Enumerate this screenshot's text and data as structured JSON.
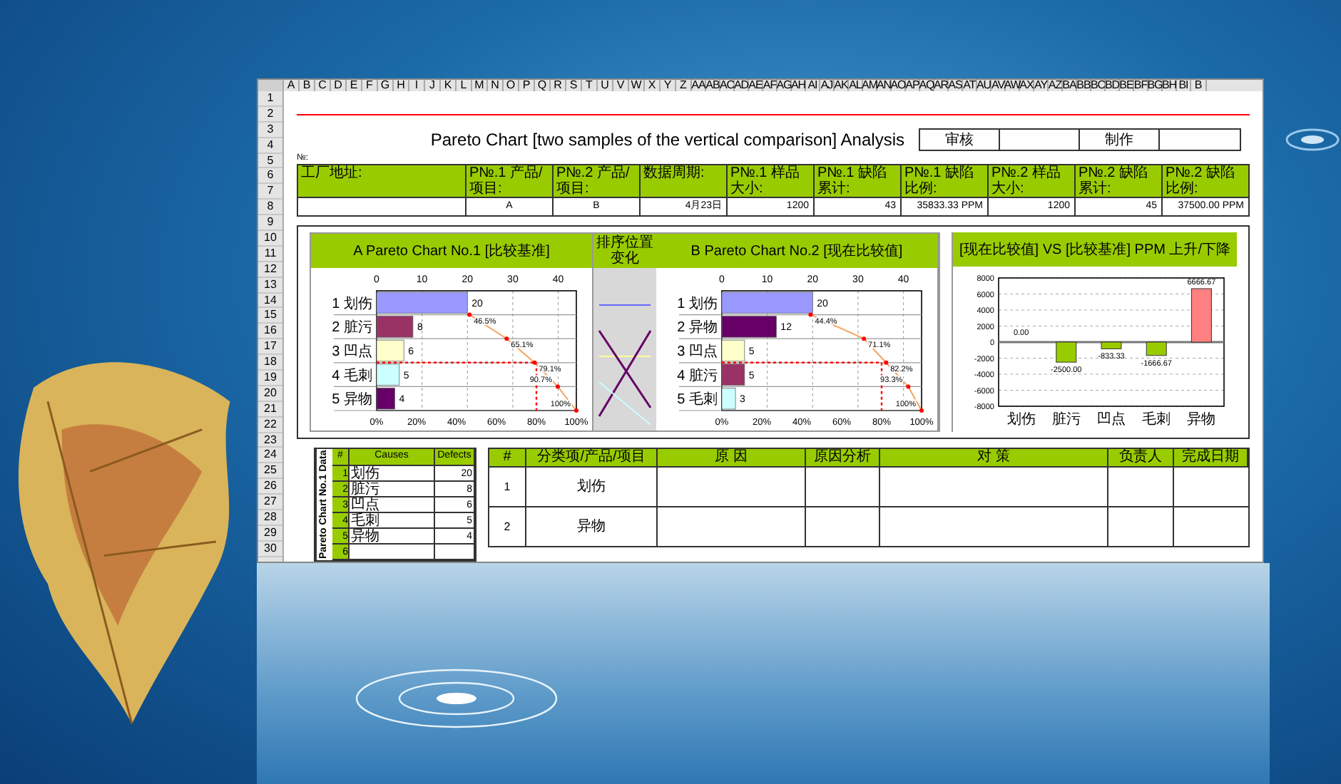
{
  "sheet": {
    "column_headers": [
      "A",
      "B",
      "C",
      "D",
      "E",
      "F",
      "G",
      "H",
      "I",
      "J",
      "K",
      "L",
      "M",
      "N",
      "O",
      "P",
      "Q",
      "R",
      "S",
      "T",
      "U",
      "V",
      "W",
      "X",
      "Y",
      "Z",
      "AA",
      "AB",
      "AC",
      "AD",
      "AE",
      "AF",
      "AG",
      "AH",
      "AI",
      "AJ",
      "AK",
      "AL",
      "AM",
      "AN",
      "AO",
      "AP",
      "AQ",
      "AR",
      "AS",
      "AT",
      "AU",
      "AV",
      "AW",
      "AX",
      "AY",
      "AZ",
      "BA",
      "BB",
      "BC",
      "BD",
      "BE",
      "BF",
      "BG",
      "BH",
      "BI",
      "B"
    ],
    "row_numbers": [
      "1",
      "2",
      "3",
      "4",
      "5",
      "6",
      "7",
      "8",
      "9",
      "10",
      "11",
      "12",
      "13",
      "14",
      "15",
      "16",
      "17",
      "18",
      "19",
      "20",
      "21",
      "22",
      "23",
      "24",
      "25",
      "26",
      "27",
      "28",
      "29",
      "30"
    ],
    "title": "Pareto Chart [two samples of the vertical comparison] Analysis",
    "signoff": [
      {
        "label": "审核"
      },
      {
        "label": "制作"
      }
    ],
    "number_label": "№:",
    "info_table": [
      {
        "label": "工厂地址:"
      },
      {
        "label": "P№.1 产品/项目:",
        "value": "A"
      },
      {
        "label": "P№.2 产品/项目:",
        "value": "B"
      },
      {
        "label": "数据周期:",
        "value": "4月23日"
      },
      {
        "label": "P№.1 样品大小:",
        "value": "1200"
      },
      {
        "label": "P№.1 缺陷累计:",
        "value": "43"
      },
      {
        "label": "P№.1 缺陷比例:",
        "value": "35833.33 PPM"
      },
      {
        "label": "P№.2 样品大小:",
        "value": "1200"
      },
      {
        "label": "P№.2 缺陷累计:",
        "value": "45"
      },
      {
        "label": "P№.2 缺陷比例:",
        "value": "37500.00 PPM"
      }
    ],
    "pareto_a": {
      "title": "A Pareto Chart No.1 [比较基准]",
      "bars": [
        {
          "color": "#9999ff"
        },
        {
          "color": "#993366"
        },
        {
          "color": "#ffffcc"
        },
        {
          "color": "#ccffff"
        },
        {
          "color": "#660066"
        }
      ],
      "chart_data": {
        "type": "bar",
        "orientation": "horizontal",
        "categories": [
          "1 划伤",
          "2 脏污",
          "3 凹点",
          "4 毛刺",
          "5 异物"
        ],
        "values": [
          20,
          8,
          6,
          5,
          4
        ],
        "xlim": [
          0,
          44
        ],
        "xticks": [
          0,
          10,
          20,
          30,
          40
        ],
        "grid": true,
        "data_labels": true,
        "ref_lines": [
          {
            "axis": "x",
            "value": 35.2,
            "color": "#ff0000"
          }
        ],
        "annotations": [
          "46.5%",
          "65.1%",
          "79.1%",
          "90.7%",
          "100%",
          "0%",
          "20%",
          "40%",
          "60%",
          "80%",
          "100%"
        ]
      }
    },
    "rank_change": {
      "title": "排序位置变化"
    },
    "pareto_b": {
      "title": "B Pareto Chart No.2 [现在比较值]",
      "bars": [
        {
          "color": "#9999ff"
        },
        {
          "color": "#660066"
        },
        {
          "color": "#ffffcc"
        },
        {
          "color": "#993366"
        },
        {
          "color": "#ccffff"
        }
      ],
      "chart_data": {
        "type": "bar",
        "orientation": "horizontal",
        "categories": [
          "1 划伤",
          "2 异物",
          "3 凹点",
          "4 脏污",
          "5 毛刺"
        ],
        "values": [
          20,
          12,
          5,
          5,
          3
        ],
        "xlim": [
          0,
          44
        ],
        "xticks": [
          0,
          10,
          20,
          30,
          40
        ],
        "grid": true,
        "data_labels": true,
        "ref_lines": [
          {
            "axis": "x",
            "value": 35.2,
            "color": "#ff0000"
          }
        ],
        "annotations": [
          "44.4%",
          "71.1%",
          "82.2%",
          "93.3%",
          "100%",
          "0%",
          "20%",
          "40%",
          "60%",
          "80%",
          "100%"
        ]
      }
    },
    "ppm_change": {
      "title": "[现在比较值] VS [比较基准] PPM 上升/下降",
      "chart_data": {
        "type": "bar",
        "categories": [
          "划伤",
          "脏污",
          "凹点",
          "毛刺",
          "异物"
        ],
        "values": [
          0,
          -2500,
          -833.33,
          -1666.67,
          6666.67
        ],
        "ylim": [
          -8000,
          8000
        ],
        "yticks": [
          -8000,
          -6000,
          -4000,
          -2000,
          0,
          2000,
          4000,
          6000,
          8000
        ],
        "grid": true,
        "value_labels": [
          "0.00",
          "-2500.00",
          "-833.33",
          "-1666.67",
          "6666.67"
        ]
      }
    },
    "defect_table": {
      "side_label": "Pareto Chart No.1 Data",
      "columns": [
        "#",
        "Causes",
        "Defects"
      ],
      "rows": [
        {
          "no": "1",
          "cause": "划伤",
          "defects": "20"
        },
        {
          "no": "2",
          "cause": "脏污",
          "defects": "8"
        },
        {
          "no": "3",
          "cause": "凹点",
          "defects": "6"
        },
        {
          "no": "4",
          "cause": "毛刺",
          "defects": "5"
        },
        {
          "no": "5",
          "cause": "异物",
          "defects": "4"
        },
        {
          "no": "6"
        }
      ]
    },
    "action_table": {
      "columns": [
        "#",
        "分类项/产品/项目",
        "原 因",
        "原因分析",
        "对 策",
        "负责人",
        "完成日期"
      ],
      "rows": [
        {
          "no": "1",
          "item": "划伤"
        },
        {
          "no": "2",
          "item": "异物"
        }
      ]
    }
  }
}
